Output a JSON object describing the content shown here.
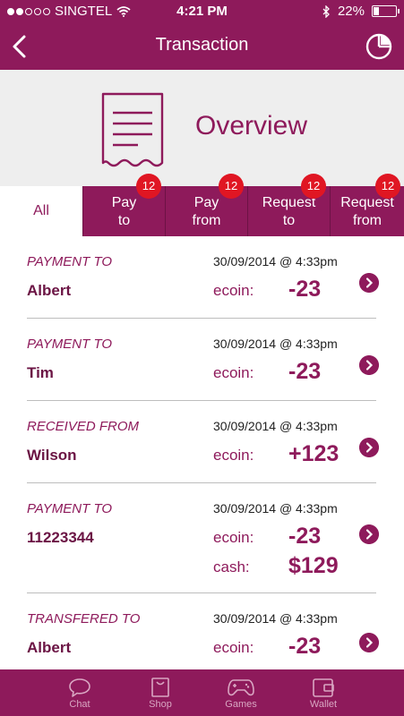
{
  "status": {
    "carrier": "SINGTEL",
    "time": "4:21 PM",
    "battery": "22%",
    "signal_icon": "signal-dots-icon",
    "wifi_icon": "wifi-icon",
    "bluetooth_icon": "bluetooth-icon"
  },
  "header": {
    "title": "Transaction"
  },
  "overview": {
    "title": "Overview"
  },
  "tabs": [
    {
      "label": "All",
      "badge": ""
    },
    {
      "label": "Pay\nto",
      "badge": "12"
    },
    {
      "label": "Pay\nfrom",
      "badge": "12"
    },
    {
      "label": "Request\nto",
      "badge": "12"
    },
    {
      "label": "Request\nfrom",
      "badge": "12"
    }
  ],
  "transactions": [
    {
      "kind": "PAYMENT TO",
      "date": "30/09/2014 @ 4:33pm",
      "name": "Albert",
      "ecoin_label": "ecoin:",
      "ecoin": "-23"
    },
    {
      "kind": "PAYMENT TO",
      "date": "30/09/2014 @ 4:33pm",
      "name": "Tim",
      "ecoin_label": "ecoin:",
      "ecoin": "-23"
    },
    {
      "kind": "RECEIVED FROM",
      "date": "30/09/2014 @ 4:33pm",
      "name": "Wilson",
      "ecoin_label": "ecoin:",
      "ecoin": "+123"
    },
    {
      "kind": "PAYMENT TO",
      "date": "30/09/2014 @ 4:33pm",
      "name": "11223344",
      "ecoin_label": "ecoin:",
      "ecoin": "-23",
      "cash_label": "cash:",
      "cash": "$129"
    },
    {
      "kind": "TRANSFERED TO",
      "date": "30/09/2014 @ 4:33pm",
      "name": "Albert",
      "ecoin_label": "ecoin:",
      "ecoin": "-23"
    }
  ],
  "bottom_nav": [
    {
      "label": "Chat",
      "icon": "chat-bubble-icon"
    },
    {
      "label": "Shop",
      "icon": "shopping-bag-icon"
    },
    {
      "label": "Games",
      "icon": "gamepad-icon"
    },
    {
      "label": "Wallet",
      "icon": "wallet-icon"
    }
  ],
  "colors": {
    "brand": "#8e1a5b",
    "badge": "#e01623",
    "panel": "#eeeeee"
  }
}
